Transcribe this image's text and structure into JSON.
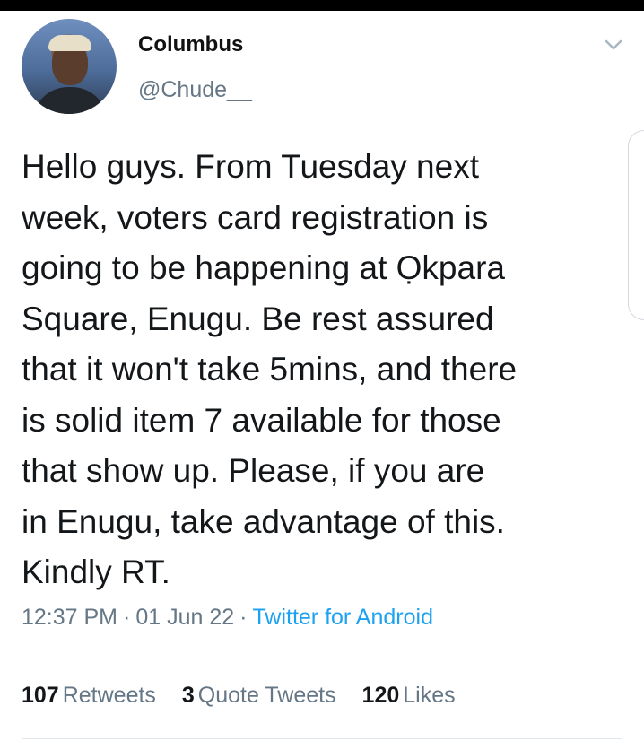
{
  "user": {
    "name": "Columbus",
    "handle": "@Chude__"
  },
  "tweet": {
    "text": "Hello guys. From Tuesday next\nweek, voters card registration is\ngoing to be happening at Ọkpara\nSquare, Enugu. Be rest assured\nthat it won't take 5mins, and there\nis solid item 7 available for those\nthat show up. Please, if you are\nin Enugu, take advantage of this.\nKindly RT.",
    "time": "12:37 PM",
    "separator": "·",
    "date": "01 Jun 22",
    "source": "Twitter for Android"
  },
  "stats": {
    "retweets_count": "107",
    "retweets_label": "Retweets",
    "quotes_count": "3",
    "quotes_label": "Quote Tweets",
    "likes_count": "120",
    "likes_label": "Likes"
  },
  "icons": {
    "menu": "chevron-down-icon",
    "avatar": "profile-photo"
  },
  "colors": {
    "link": "#1da1f2",
    "secondary_text": "#657786",
    "primary_text": "#14171a"
  }
}
